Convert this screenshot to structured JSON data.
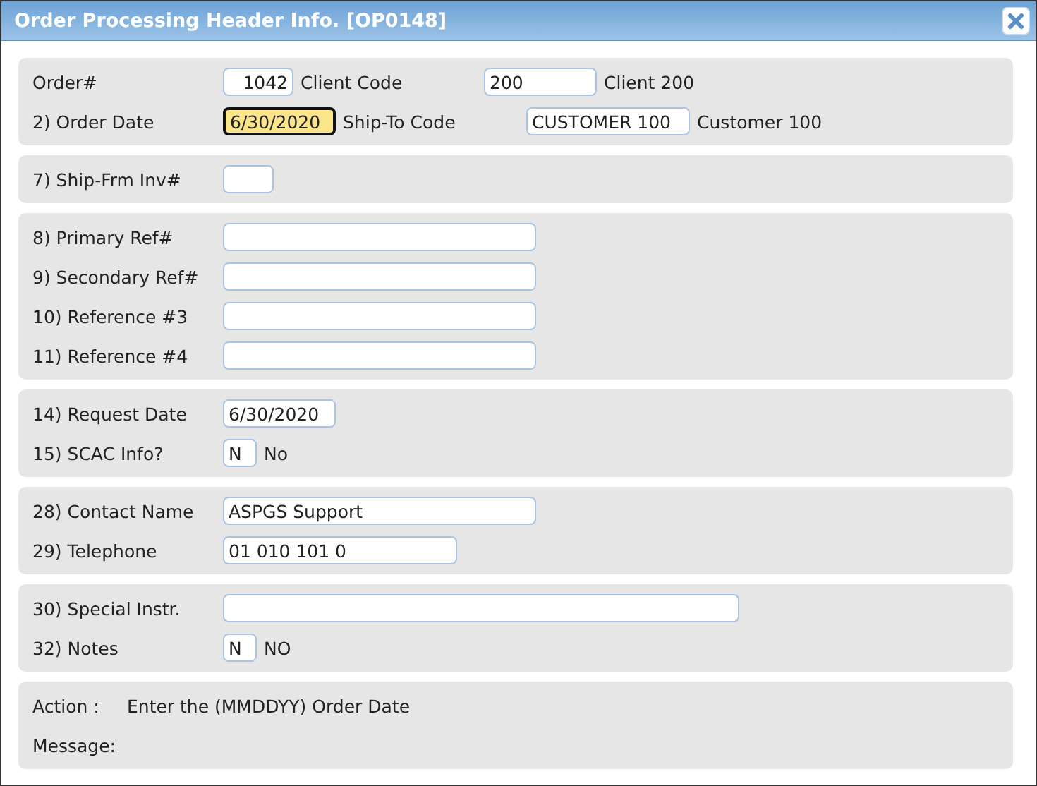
{
  "window": {
    "title": "Order Processing Header Info. [OP0148]"
  },
  "sections": [
    {
      "rows": [
        {
          "label": "Order#",
          "items": [
            {
              "kind": "field",
              "value": "1042",
              "focused": false
            },
            {
              "kind": "caption",
              "text": "Client Code"
            },
            {
              "kind": "field",
              "value": "200",
              "focused": false
            },
            {
              "kind": "text",
              "text": "Client 200"
            }
          ]
        },
        {
          "label": "2) Order Date",
          "items": [
            {
              "kind": "field",
              "value": "6/30/2020",
              "focused": true
            },
            {
              "kind": "caption",
              "text": "Ship-To Code"
            },
            {
              "kind": "field",
              "value": "CUSTOMER 100",
              "focused": false
            },
            {
              "kind": "text",
              "text": "Customer 100"
            }
          ]
        }
      ]
    },
    {
      "rows": [
        {
          "label": "7) Ship-Frm Inv#",
          "items": [
            {
              "kind": "field",
              "focused": false
            }
          ]
        }
      ]
    },
    {
      "rows": [
        {
          "label": "8) Primary Ref#",
          "items": [
            {
              "kind": "field",
              "focused": false
            }
          ]
        },
        {
          "label": "9) Secondary Ref#",
          "items": [
            {
              "kind": "field",
              "focused": false
            }
          ]
        },
        {
          "label": "10) Reference #3",
          "items": [
            {
              "kind": "field",
              "focused": false
            }
          ]
        },
        {
          "label": "11) Reference #4",
          "items": [
            {
              "kind": "field",
              "focused": false
            }
          ]
        }
      ]
    },
    {
      "rows": [
        {
          "label": "14) Request Date",
          "items": [
            {
              "kind": "field",
              "value": "6/30/2020",
              "focused": false
            }
          ]
        },
        {
          "label": "15) SCAC Info?",
          "items": [
            {
              "kind": "field",
              "value": "N",
              "focused": false
            },
            {
              "kind": "text",
              "text": "No"
            }
          ]
        }
      ]
    },
    {
      "rows": [
        {
          "label": "28) Contact Name",
          "items": [
            {
              "kind": "field",
              "value": "ASPGS Support",
              "focused": false
            }
          ]
        },
        {
          "label": "29) Telephone",
          "items": [
            {
              "kind": "field",
              "value": "01 010 101 0",
              "focused": false
            }
          ]
        }
      ]
    },
    {
      "rows": [
        {
          "label": "30) Special Instr.",
          "items": [
            {
              "kind": "field",
              "focused": false
            }
          ]
        },
        {
          "label": "32) Notes",
          "items": [
            {
              "kind": "field",
              "value": "N",
              "focused": false
            },
            {
              "kind": "text",
              "text": "NO"
            }
          ]
        }
      ]
    }
  ],
  "status": {
    "action_label": "Action :",
    "action_text": "Enter the (MMDDYY) Order Date",
    "message_label": "Message:"
  }
}
